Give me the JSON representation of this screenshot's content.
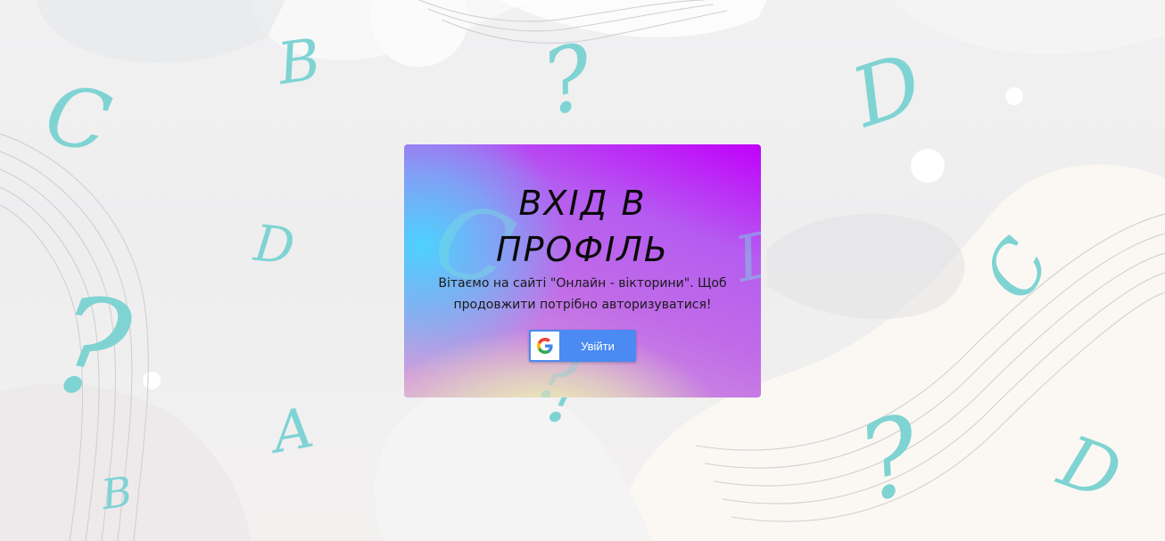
{
  "login": {
    "title_line1": "ВХІД В",
    "title_line2": "ПРОФІЛЬ",
    "welcome_text": "Вітаємо на сайті \"Онлайн - вікторини\". Щоб продовжити потрібно авторизуватися!",
    "google_button_label": "Увійти"
  },
  "background": {
    "glyphs": [
      "C",
      "B",
      "?",
      "D",
      "D",
      "?",
      "C",
      "A",
      "B",
      "?",
      "?",
      "D",
      "C",
      "D",
      "?"
    ]
  },
  "colors": {
    "accent_teal": "#7fd3d3",
    "google_blue": "#4a8af2",
    "card_purple": "#c100fb",
    "card_cyan": "#46d7ff",
    "card_yellow": "#f5ffaa"
  },
  "icons": {
    "google": "google-g-logo"
  }
}
